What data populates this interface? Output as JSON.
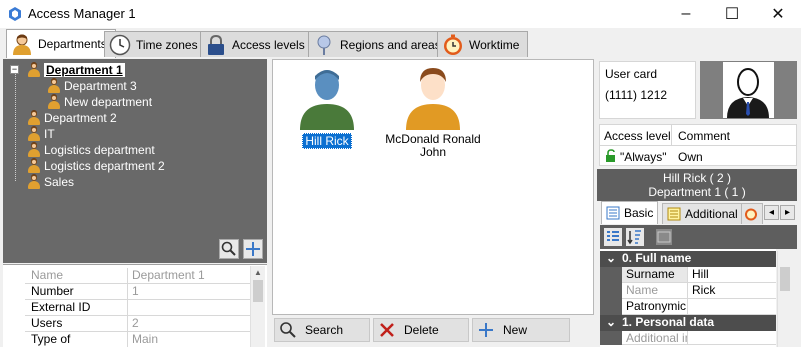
{
  "window": {
    "title": "Access Manager 1",
    "minimize": "–",
    "maximize": "☐",
    "close": "✕"
  },
  "tabs": [
    {
      "label": "Departments",
      "icon": "person-icon",
      "active": true
    },
    {
      "label": "Time zones",
      "icon": "clock-icon"
    },
    {
      "label": "Access levels",
      "icon": "lock-icon"
    },
    {
      "label": "Regions and areas",
      "icon": "pin-icon"
    },
    {
      "label": "Worktime",
      "icon": "stopwatch-icon"
    }
  ],
  "tree": {
    "expander": "−",
    "root": "Department 1",
    "children": [
      "Department 3",
      "New department"
    ],
    "others": [
      "Department 2",
      "IT",
      "Logistics department",
      "Logistics department 2",
      "Sales"
    ]
  },
  "properties": {
    "rows": [
      {
        "key": "Name",
        "value": "Department 1",
        "greyed": true
      },
      {
        "key": "Number",
        "value": "1"
      },
      {
        "key": "External ID",
        "value": ""
      },
      {
        "key": "Users",
        "value": "2"
      },
      {
        "key": "Type of department",
        "value": "Main"
      }
    ],
    "scroll_up": "▲"
  },
  "users": [
    {
      "name": "Hill Rick",
      "selected": true
    },
    {
      "name": "McDonald Ronald John",
      "selected": false
    }
  ],
  "buttons": {
    "search": "Search",
    "delete": "Delete",
    "new": "New"
  },
  "card": {
    "user_card_label": "User card",
    "user_card_value": "(1111) 1212",
    "access_level_header": "Access level",
    "comment_header": "Comment",
    "access_level_value": "\"Always\"",
    "comment_value": "Own"
  },
  "summary": {
    "line1": "Hill Rick ( 2 )",
    "line2": "Department 1 ( 1 )"
  },
  "right_tabs": [
    {
      "label": "Basic",
      "active": true
    },
    {
      "label": "Additional",
      "active": false
    }
  ],
  "right_nav": {
    "left": "◂",
    "right": "▸"
  },
  "grid": {
    "sections": [
      {
        "title": "0. Full name",
        "rows": [
          {
            "key": "Surname",
            "value": "Hill"
          },
          {
            "key": "Name",
            "value": "Rick",
            "greyed": true
          },
          {
            "key": "Patronymic",
            "value": ""
          }
        ]
      },
      {
        "title": "1. Personal data",
        "rows": [
          {
            "key": "Additional inf",
            "value": ""
          }
        ]
      }
    ],
    "collapse": "⌄"
  },
  "colors": {
    "tree_bg": "#696969",
    "selected_bg": "#0b6fd1",
    "section_bg": "#4d4d4d"
  }
}
